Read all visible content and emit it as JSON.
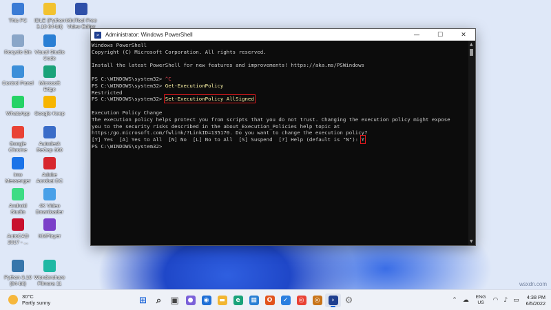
{
  "desktop": {
    "icons": [
      {
        "label": "This PC",
        "icon": "computer-icon",
        "color": "#3a7bd5"
      },
      {
        "label": "IDLE (Python\n3.10 64-bit)",
        "icon": "python-icon",
        "color": "#f2c230"
      },
      {
        "label": "MiniTool Free\nVideo Editor",
        "icon": "minitool-icon",
        "color": "#2e4fa8"
      },
      {
        "label": "Recycle Bin",
        "icon": "recycle-bin-icon",
        "color": "#8aa6c8"
      },
      {
        "label": "Visual Studio\nCode",
        "icon": "vscode-icon",
        "color": "#2a7fd4"
      },
      {
        "label": "Control Panel",
        "icon": "control-panel-icon",
        "color": "#3c8fd9"
      },
      {
        "label": "Microsoft\nEdge",
        "icon": "edge-icon",
        "color": "#1aa37a"
      },
      {
        "label": "WhatsApp",
        "icon": "whatsapp-icon",
        "color": "#25d366"
      },
      {
        "label": "Google Keep",
        "icon": "google-keep-icon",
        "color": "#f7b500"
      },
      {
        "label": "Google\nChrome",
        "icon": "chrome-icon",
        "color": "#e94235"
      },
      {
        "label": "Autodesk\nReCap 360",
        "icon": "recap-icon",
        "color": "#3a6cc8"
      },
      {
        "label": "Imo\nMessenger",
        "icon": "imo-icon",
        "color": "#1a73e8"
      },
      {
        "label": "Adobe\nAcrobat DC",
        "icon": "acrobat-icon",
        "color": "#d7262d"
      },
      {
        "label": "Android\nStudio",
        "icon": "android-studio-icon",
        "color": "#3ddc84"
      },
      {
        "label": "4K Video\nDownloader",
        "icon": "4k-downloader-icon",
        "color": "#49a0e8"
      },
      {
        "label": "AutoCAD\n2017 - ...",
        "icon": "autocad-icon",
        "color": "#c8102e"
      },
      {
        "label": "KMPlayer",
        "icon": "kmplayer-icon",
        "color": "#7a3fc8"
      },
      {
        "label": "Python 3.10\n(64-bit)",
        "icon": "python-3-10-icon",
        "color": "#3776ab"
      },
      {
        "label": "Wondershare\nFilmora 11",
        "icon": "filmora-icon",
        "color": "#1fb8a4"
      }
    ]
  },
  "window": {
    "title": "Administrator: Windows PowerShell",
    "minimize": "—",
    "maximize": "☐",
    "close": "✕"
  },
  "console": {
    "lines": [
      {
        "prompt": "",
        "cmd": "",
        "text": "Windows PowerShell"
      },
      {
        "prompt": "",
        "cmd": "",
        "text": "Copyright (C) Microsoft Corporation. All rights reserved."
      },
      {
        "prompt": "",
        "cmd": "",
        "text": ""
      },
      {
        "prompt": "",
        "cmd": "",
        "text": "Install the latest PowerShell for new features and improvements! https://aka.ms/PSWindows"
      },
      {
        "prompt": "",
        "cmd": "",
        "text": ""
      },
      {
        "prompt": "PS C:\\WINDOWS\\system32> ",
        "cmd": "^C",
        "text": ""
      },
      {
        "prompt": "PS C:\\WINDOWS\\system32> ",
        "cmd": "Get-ExecutionPolicy",
        "text": ""
      },
      {
        "prompt": "",
        "cmd": "",
        "text": "Restricted"
      },
      {
        "prompt": "PS C:\\WINDOWS\\system32> ",
        "cmd": "Set-ExecutionPolicy AllSigned",
        "text": ""
      },
      {
        "prompt": "",
        "cmd": "",
        "text": ""
      },
      {
        "prompt": "",
        "cmd": "",
        "text": "Execution Policy Change"
      },
      {
        "prompt": "",
        "cmd": "",
        "text": "The execution policy helps protect you from scripts that you do not trust. Changing the execution policy might expose"
      },
      {
        "prompt": "",
        "cmd": "",
        "text": "you to the security risks described in the about_Execution_Policies help topic at"
      },
      {
        "prompt": "",
        "cmd": "",
        "text": "https:/go.microsoft.com/fwlink/?LinkID=135170. Do you want to change the execution policy?"
      },
      {
        "prompt": "",
        "cmd": "",
        "text": "[Y] Yes  [A] Yes to All  [N] No  [L] No to All  [S] Suspend  [?] Help (default is \"N\"): ",
        "answer": "Y"
      },
      {
        "prompt": "PS C:\\WINDOWS\\system32> ",
        "cmd": "",
        "text": ""
      }
    ]
  },
  "taskbar": {
    "weather_temp": "30°C",
    "weather_desc": "Partly sunny",
    "apps": [
      {
        "name": "windows-start-icon",
        "glyph": "⊞",
        "color": "#1a64d8"
      },
      {
        "name": "search-icon",
        "glyph": "⌕",
        "color": "#333333"
      },
      {
        "name": "task-view-icon",
        "glyph": "▣",
        "color": "#444444"
      },
      {
        "name": "chat-icon",
        "glyph": "●",
        "color": "#7b61d9"
      },
      {
        "name": "camera-icon",
        "glyph": "◉",
        "color": "#1f6fd6"
      },
      {
        "name": "file-explorer-icon",
        "glyph": "▬",
        "color": "#f2b632"
      },
      {
        "name": "edge-icon",
        "glyph": "e",
        "color": "#1aa37a"
      },
      {
        "name": "store-icon",
        "glyph": "▦",
        "color": "#2a7fd4"
      },
      {
        "name": "office-icon",
        "glyph": "O",
        "color": "#e2531d"
      },
      {
        "name": "todo-icon",
        "glyph": "✓",
        "color": "#2b7fe0"
      },
      {
        "name": "chrome-icon",
        "glyph": "◎",
        "color": "#e94235"
      },
      {
        "name": "chrome-canary-icon",
        "glyph": "◎",
        "color": "#c8741a"
      },
      {
        "name": "powershell-icon",
        "glyph": "›",
        "color": "#1f3f8f",
        "active": true
      },
      {
        "name": "settings-icon",
        "glyph": "⚙",
        "color": "#777777"
      }
    ],
    "lang_line1": "ENG",
    "lang_line2": "US",
    "time": "4:38 PM",
    "date": "6/5/2022"
  },
  "watermark": "wsxdn.com"
}
